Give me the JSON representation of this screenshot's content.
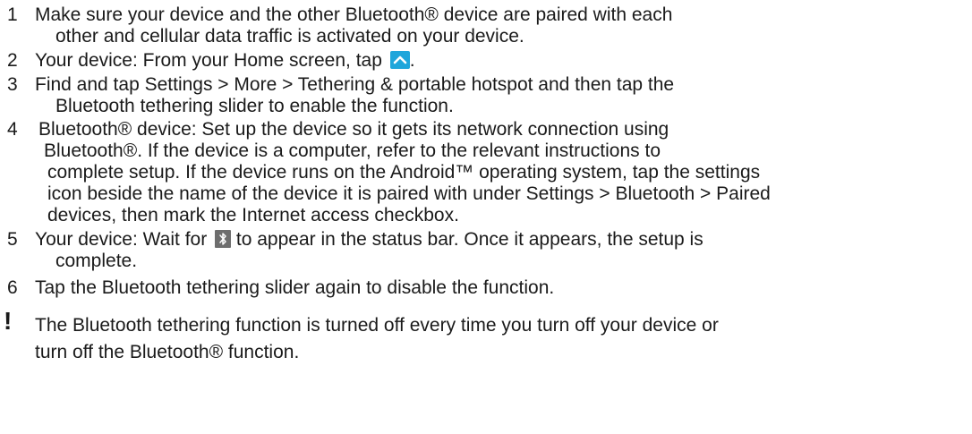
{
  "steps": [
    {
      "number": "1",
      "lines": [
        "Make sure your device and the other Bluetooth® device are paired with each",
        "other and cellular data traffic is activated on your device."
      ]
    },
    {
      "number": "2",
      "before_icon": "Your device: From your Home screen, tap",
      "icon": "apps-up-chevron-icon",
      "after_icon": "."
    },
    {
      "number": "3",
      "lines": [
        "Find and tap Settings > More > Tethering & portable hotspot and then tap the",
        "Bluetooth tethering slider to enable the function."
      ]
    },
    {
      "number": "4",
      "lines": [
        "Bluetooth® device: Set up the device so it gets its network connection using",
        "Bluetooth®. If the device is a computer, refer to the relevant instructions to",
        "complete setup. If the device runs on the Android™ operating system, tap the settings",
        "icon beside the name of the device it is paired with under Settings > Bluetooth > Paired",
        "devices, then mark the Internet access checkbox."
      ]
    },
    {
      "number": "5",
      "before_icon": "Your device: Wait for",
      "icon": "bluetooth-status-icon",
      "after_icon": "to appear in the status bar. Once it appears, the setup is",
      "continuation": "complete."
    },
    {
      "number": "6",
      "lines": [
        "Tap the Bluetooth tethering slider again to disable the function."
      ]
    }
  ],
  "note": {
    "mark": "!",
    "lines": [
      "The Bluetooth tethering function is turned off every time you turn off your device or",
      "turn off the Bluetooth® function."
    ]
  },
  "colors": {
    "text": "#1a1a1a",
    "up_icon_bg": "#1fa6db",
    "bt_icon_bg": "#6e6e6e"
  }
}
